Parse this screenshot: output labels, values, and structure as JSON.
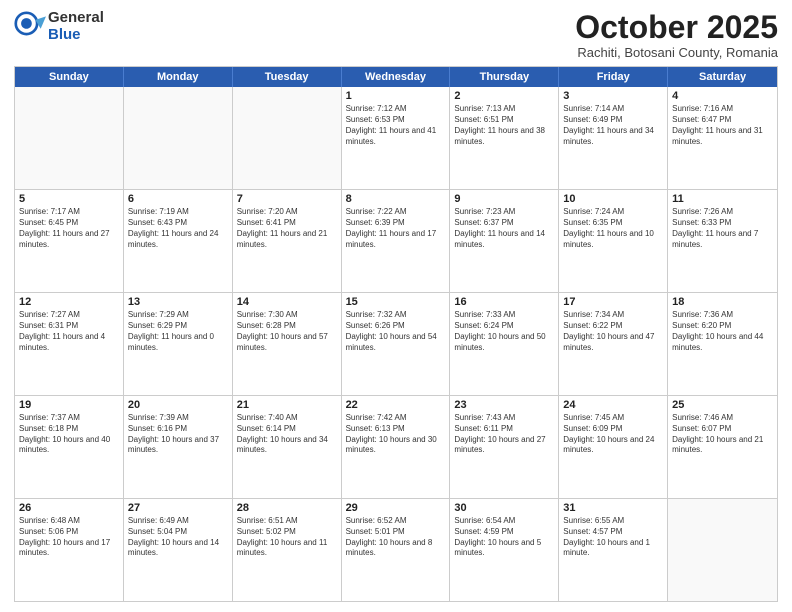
{
  "header": {
    "logo_general": "General",
    "logo_blue": "Blue",
    "month_title": "October 2025",
    "location": "Rachiti, Botosani County, Romania"
  },
  "calendar": {
    "days_of_week": [
      "Sunday",
      "Monday",
      "Tuesday",
      "Wednesday",
      "Thursday",
      "Friday",
      "Saturday"
    ],
    "rows": [
      [
        {
          "day": "",
          "empty": true
        },
        {
          "day": "",
          "empty": true
        },
        {
          "day": "",
          "empty": true
        },
        {
          "day": "1",
          "sunrise": "7:12 AM",
          "sunset": "6:53 PM",
          "daylight": "11 hours and 41 minutes."
        },
        {
          "day": "2",
          "sunrise": "7:13 AM",
          "sunset": "6:51 PM",
          "daylight": "11 hours and 38 minutes."
        },
        {
          "day": "3",
          "sunrise": "7:14 AM",
          "sunset": "6:49 PM",
          "daylight": "11 hours and 34 minutes."
        },
        {
          "day": "4",
          "sunrise": "7:16 AM",
          "sunset": "6:47 PM",
          "daylight": "11 hours and 31 minutes."
        }
      ],
      [
        {
          "day": "5",
          "sunrise": "7:17 AM",
          "sunset": "6:45 PM",
          "daylight": "11 hours and 27 minutes."
        },
        {
          "day": "6",
          "sunrise": "7:19 AM",
          "sunset": "6:43 PM",
          "daylight": "11 hours and 24 minutes."
        },
        {
          "day": "7",
          "sunrise": "7:20 AM",
          "sunset": "6:41 PM",
          "daylight": "11 hours and 21 minutes."
        },
        {
          "day": "8",
          "sunrise": "7:22 AM",
          "sunset": "6:39 PM",
          "daylight": "11 hours and 17 minutes."
        },
        {
          "day": "9",
          "sunrise": "7:23 AM",
          "sunset": "6:37 PM",
          "daylight": "11 hours and 14 minutes."
        },
        {
          "day": "10",
          "sunrise": "7:24 AM",
          "sunset": "6:35 PM",
          "daylight": "11 hours and 10 minutes."
        },
        {
          "day": "11",
          "sunrise": "7:26 AM",
          "sunset": "6:33 PM",
          "daylight": "11 hours and 7 minutes."
        }
      ],
      [
        {
          "day": "12",
          "sunrise": "7:27 AM",
          "sunset": "6:31 PM",
          "daylight": "11 hours and 4 minutes."
        },
        {
          "day": "13",
          "sunrise": "7:29 AM",
          "sunset": "6:29 PM",
          "daylight": "11 hours and 0 minutes."
        },
        {
          "day": "14",
          "sunrise": "7:30 AM",
          "sunset": "6:28 PM",
          "daylight": "10 hours and 57 minutes."
        },
        {
          "day": "15",
          "sunrise": "7:32 AM",
          "sunset": "6:26 PM",
          "daylight": "10 hours and 54 minutes."
        },
        {
          "day": "16",
          "sunrise": "7:33 AM",
          "sunset": "6:24 PM",
          "daylight": "10 hours and 50 minutes."
        },
        {
          "day": "17",
          "sunrise": "7:34 AM",
          "sunset": "6:22 PM",
          "daylight": "10 hours and 47 minutes."
        },
        {
          "day": "18",
          "sunrise": "7:36 AM",
          "sunset": "6:20 PM",
          "daylight": "10 hours and 44 minutes."
        }
      ],
      [
        {
          "day": "19",
          "sunrise": "7:37 AM",
          "sunset": "6:18 PM",
          "daylight": "10 hours and 40 minutes."
        },
        {
          "day": "20",
          "sunrise": "7:39 AM",
          "sunset": "6:16 PM",
          "daylight": "10 hours and 37 minutes."
        },
        {
          "day": "21",
          "sunrise": "7:40 AM",
          "sunset": "6:14 PM",
          "daylight": "10 hours and 34 minutes."
        },
        {
          "day": "22",
          "sunrise": "7:42 AM",
          "sunset": "6:13 PM",
          "daylight": "10 hours and 30 minutes."
        },
        {
          "day": "23",
          "sunrise": "7:43 AM",
          "sunset": "6:11 PM",
          "daylight": "10 hours and 27 minutes."
        },
        {
          "day": "24",
          "sunrise": "7:45 AM",
          "sunset": "6:09 PM",
          "daylight": "10 hours and 24 minutes."
        },
        {
          "day": "25",
          "sunrise": "7:46 AM",
          "sunset": "6:07 PM",
          "daylight": "10 hours and 21 minutes."
        }
      ],
      [
        {
          "day": "26",
          "sunrise": "6:48 AM",
          "sunset": "5:06 PM",
          "daylight": "10 hours and 17 minutes."
        },
        {
          "day": "27",
          "sunrise": "6:49 AM",
          "sunset": "5:04 PM",
          "daylight": "10 hours and 14 minutes."
        },
        {
          "day": "28",
          "sunrise": "6:51 AM",
          "sunset": "5:02 PM",
          "daylight": "10 hours and 11 minutes."
        },
        {
          "day": "29",
          "sunrise": "6:52 AM",
          "sunset": "5:01 PM",
          "daylight": "10 hours and 8 minutes."
        },
        {
          "day": "30",
          "sunrise": "6:54 AM",
          "sunset": "4:59 PM",
          "daylight": "10 hours and 5 minutes."
        },
        {
          "day": "31",
          "sunrise": "6:55 AM",
          "sunset": "4:57 PM",
          "daylight": "10 hours and 1 minute."
        },
        {
          "day": "",
          "empty": true
        }
      ]
    ]
  }
}
